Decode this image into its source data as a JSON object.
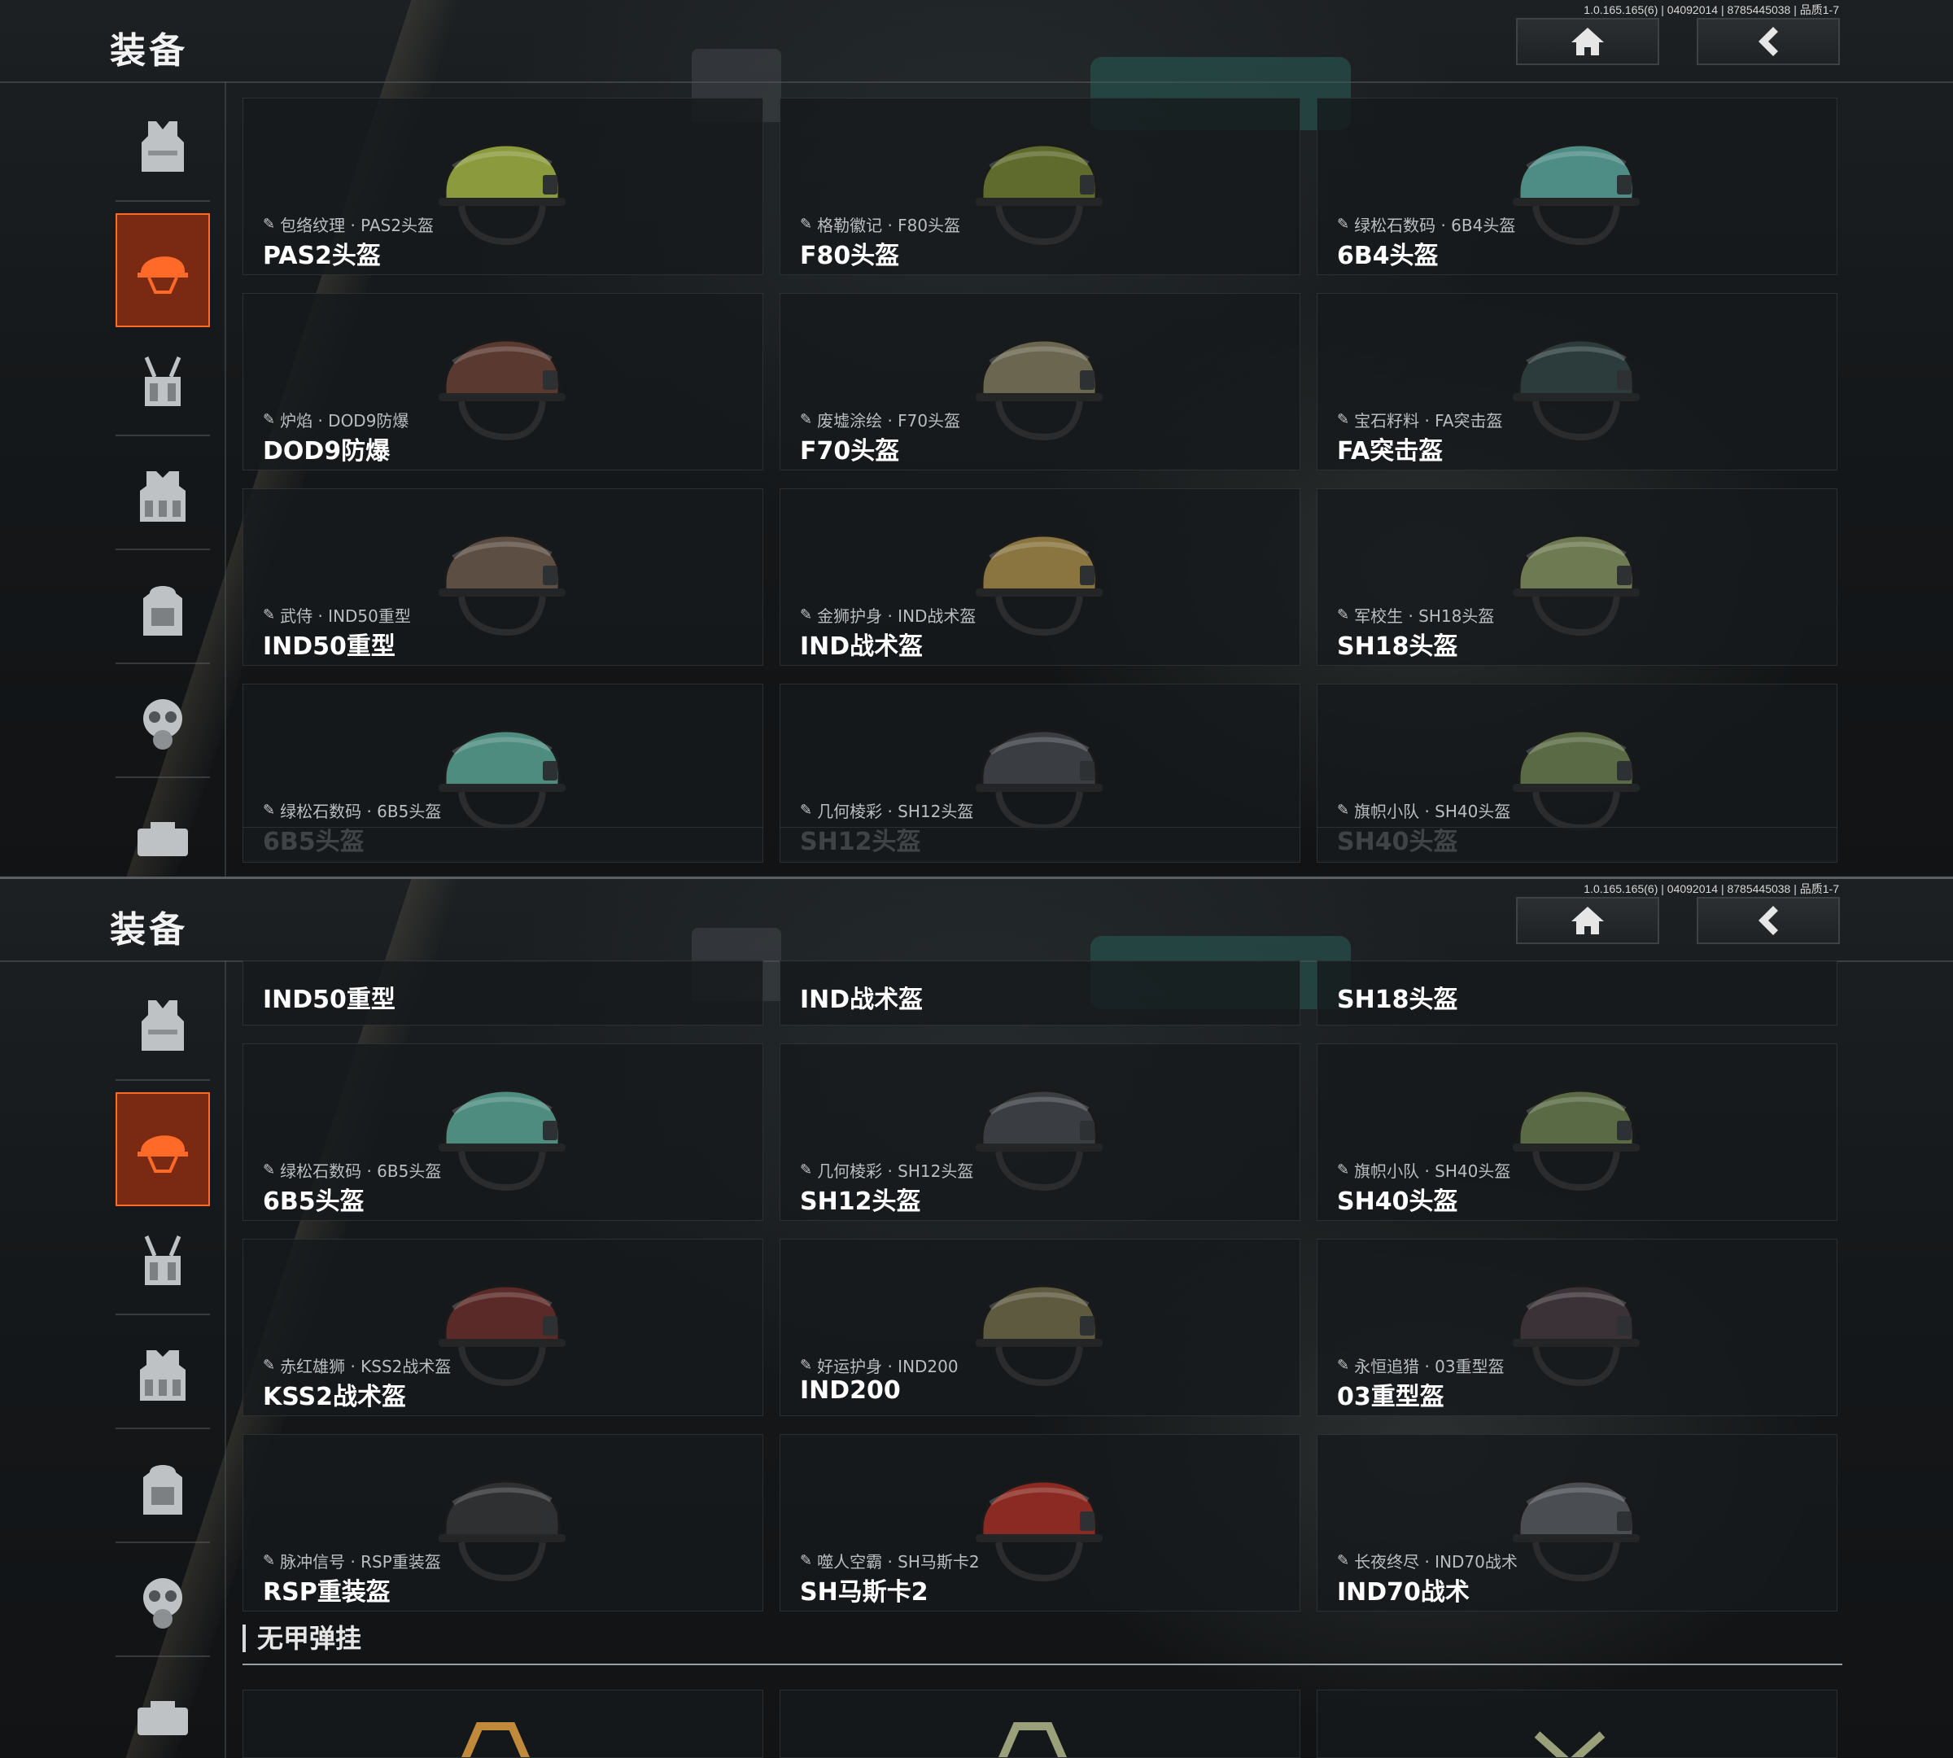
{
  "header": {
    "title": "装备",
    "version": "1.0.165.165(6) | 04092014 | 8785445038 | 品质1-7",
    "home_icon": "home-icon",
    "back_icon": "chevron-left-icon"
  },
  "sidebar": {
    "items": [
      {
        "icon": "vest-icon",
        "active": false
      },
      {
        "icon": "helmet-icon",
        "active": true
      },
      {
        "icon": "chest-rig-icon",
        "active": false
      },
      {
        "icon": "armored-rig-icon",
        "active": false
      },
      {
        "icon": "backpack-icon",
        "active": false
      },
      {
        "icon": "gas-mask-icon",
        "active": false
      },
      {
        "icon": "case-icon",
        "active": false
      }
    ]
  },
  "colors": {
    "accent": "#ff6a28",
    "active_bg": "#7a2a12"
  },
  "top_panel": {
    "cards": [
      {
        "skin": "包络纹理 · PAS2头盔",
        "name": "PAS2头盔",
        "color": "#8a9a3c"
      },
      {
        "skin": "格勒徽记 · F80头盔",
        "name": "F80头盔",
        "color": "#5f6b2c"
      },
      {
        "skin": "绿松石数码 · 6B4头盔",
        "name": "6B4头盔",
        "color": "#4e8c86"
      },
      {
        "skin": "炉焰 · DOD9防爆",
        "name": "DOD9防爆",
        "color": "#5a3a30"
      },
      {
        "skin": "废墟涂绘 · F70头盔",
        "name": "F70头盔",
        "color": "#6b6650"
      },
      {
        "skin": "宝石籽料 · FA突击盔",
        "name": "FA突击盔",
        "color": "#2c3c3c"
      },
      {
        "skin": "武侍 · IND50重型",
        "name": "IND50重型",
        "color": "#5c4e42"
      },
      {
        "skin": "金狮护身 · IND战术盔",
        "name": "IND战术盔",
        "color": "#8a7440"
      },
      {
        "skin": "军校生 · SH18头盔",
        "name": "SH18头盔",
        "color": "#6e7a52"
      },
      {
        "skin": "绿松石数码 · 6B5头盔",
        "name": "6B5头盔",
        "color": "#4e8c80"
      },
      {
        "skin": "几何棱彩 · SH12头盔",
        "name": "SH12头盔",
        "color": "#3a3e42"
      },
      {
        "skin": "旗帜小队 · SH40头盔",
        "name": "SH40头盔",
        "color": "#5a6a44"
      }
    ]
  },
  "bottom_panel": {
    "partial_names": [
      "IND50重型",
      "IND战术盔",
      "SH18头盔"
    ],
    "cards": [
      {
        "skin": "绿松石数码 · 6B5头盔",
        "name": "6B5头盔",
        "color": "#4e8c80"
      },
      {
        "skin": "几何棱彩 · SH12头盔",
        "name": "SH12头盔",
        "color": "#3a3e42"
      },
      {
        "skin": "旗帜小队 · SH40头盔",
        "name": "SH40头盔",
        "color": "#5a6a44"
      },
      {
        "skin": "赤红雄狮 · KSS2战术盔",
        "name": "KSS2战术盔",
        "color": "#5a2a28"
      },
      {
        "skin": "好运护身 · IND200",
        "name": "IND200",
        "color": "#5e5a40"
      },
      {
        "skin": "永恒追猎 · 03重型盔",
        "name": "03重型盔",
        "color": "#3a3236"
      },
      {
        "skin": "脉冲信号 · RSP重装盔",
        "name": "RSP重装盔",
        "color": "#2e3032"
      },
      {
        "skin": "噬人空霸 · SH马斯卡2",
        "name": "SH马斯卡2",
        "color": "#8a2a22"
      },
      {
        "skin": "长夜终尽 · IND70战术",
        "name": "IND70战术",
        "color": "#4a4e52"
      }
    ],
    "section_title": "无甲弹挂"
  }
}
